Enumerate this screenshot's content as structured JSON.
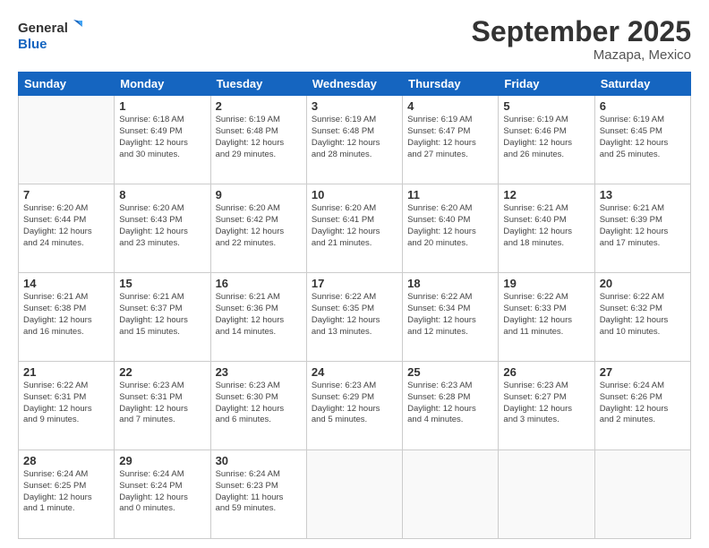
{
  "logo": {
    "line1": "General",
    "line2": "Blue"
  },
  "title": "September 2025",
  "location": "Mazapa, Mexico",
  "weekdays": [
    "Sunday",
    "Monday",
    "Tuesday",
    "Wednesday",
    "Thursday",
    "Friday",
    "Saturday"
  ],
  "weeks": [
    [
      {
        "day": "",
        "info": ""
      },
      {
        "day": "1",
        "info": "Sunrise: 6:18 AM\nSunset: 6:49 PM\nDaylight: 12 hours\nand 30 minutes."
      },
      {
        "day": "2",
        "info": "Sunrise: 6:19 AM\nSunset: 6:48 PM\nDaylight: 12 hours\nand 29 minutes."
      },
      {
        "day": "3",
        "info": "Sunrise: 6:19 AM\nSunset: 6:48 PM\nDaylight: 12 hours\nand 28 minutes."
      },
      {
        "day": "4",
        "info": "Sunrise: 6:19 AM\nSunset: 6:47 PM\nDaylight: 12 hours\nand 27 minutes."
      },
      {
        "day": "5",
        "info": "Sunrise: 6:19 AM\nSunset: 6:46 PM\nDaylight: 12 hours\nand 26 minutes."
      },
      {
        "day": "6",
        "info": "Sunrise: 6:19 AM\nSunset: 6:45 PM\nDaylight: 12 hours\nand 25 minutes."
      }
    ],
    [
      {
        "day": "7",
        "info": "Sunrise: 6:20 AM\nSunset: 6:44 PM\nDaylight: 12 hours\nand 24 minutes."
      },
      {
        "day": "8",
        "info": "Sunrise: 6:20 AM\nSunset: 6:43 PM\nDaylight: 12 hours\nand 23 minutes."
      },
      {
        "day": "9",
        "info": "Sunrise: 6:20 AM\nSunset: 6:42 PM\nDaylight: 12 hours\nand 22 minutes."
      },
      {
        "day": "10",
        "info": "Sunrise: 6:20 AM\nSunset: 6:41 PM\nDaylight: 12 hours\nand 21 minutes."
      },
      {
        "day": "11",
        "info": "Sunrise: 6:20 AM\nSunset: 6:40 PM\nDaylight: 12 hours\nand 20 minutes."
      },
      {
        "day": "12",
        "info": "Sunrise: 6:21 AM\nSunset: 6:40 PM\nDaylight: 12 hours\nand 18 minutes."
      },
      {
        "day": "13",
        "info": "Sunrise: 6:21 AM\nSunset: 6:39 PM\nDaylight: 12 hours\nand 17 minutes."
      }
    ],
    [
      {
        "day": "14",
        "info": "Sunrise: 6:21 AM\nSunset: 6:38 PM\nDaylight: 12 hours\nand 16 minutes."
      },
      {
        "day": "15",
        "info": "Sunrise: 6:21 AM\nSunset: 6:37 PM\nDaylight: 12 hours\nand 15 minutes."
      },
      {
        "day": "16",
        "info": "Sunrise: 6:21 AM\nSunset: 6:36 PM\nDaylight: 12 hours\nand 14 minutes."
      },
      {
        "day": "17",
        "info": "Sunrise: 6:22 AM\nSunset: 6:35 PM\nDaylight: 12 hours\nand 13 minutes."
      },
      {
        "day": "18",
        "info": "Sunrise: 6:22 AM\nSunset: 6:34 PM\nDaylight: 12 hours\nand 12 minutes."
      },
      {
        "day": "19",
        "info": "Sunrise: 6:22 AM\nSunset: 6:33 PM\nDaylight: 12 hours\nand 11 minutes."
      },
      {
        "day": "20",
        "info": "Sunrise: 6:22 AM\nSunset: 6:32 PM\nDaylight: 12 hours\nand 10 minutes."
      }
    ],
    [
      {
        "day": "21",
        "info": "Sunrise: 6:22 AM\nSunset: 6:31 PM\nDaylight: 12 hours\nand 9 minutes."
      },
      {
        "day": "22",
        "info": "Sunrise: 6:23 AM\nSunset: 6:31 PM\nDaylight: 12 hours\nand 7 minutes."
      },
      {
        "day": "23",
        "info": "Sunrise: 6:23 AM\nSunset: 6:30 PM\nDaylight: 12 hours\nand 6 minutes."
      },
      {
        "day": "24",
        "info": "Sunrise: 6:23 AM\nSunset: 6:29 PM\nDaylight: 12 hours\nand 5 minutes."
      },
      {
        "day": "25",
        "info": "Sunrise: 6:23 AM\nSunset: 6:28 PM\nDaylight: 12 hours\nand 4 minutes."
      },
      {
        "day": "26",
        "info": "Sunrise: 6:23 AM\nSunset: 6:27 PM\nDaylight: 12 hours\nand 3 minutes."
      },
      {
        "day": "27",
        "info": "Sunrise: 6:24 AM\nSunset: 6:26 PM\nDaylight: 12 hours\nand 2 minutes."
      }
    ],
    [
      {
        "day": "28",
        "info": "Sunrise: 6:24 AM\nSunset: 6:25 PM\nDaylight: 12 hours\nand 1 minute."
      },
      {
        "day": "29",
        "info": "Sunrise: 6:24 AM\nSunset: 6:24 PM\nDaylight: 12 hours\nand 0 minutes."
      },
      {
        "day": "30",
        "info": "Sunrise: 6:24 AM\nSunset: 6:23 PM\nDaylight: 11 hours\nand 59 minutes."
      },
      {
        "day": "",
        "info": ""
      },
      {
        "day": "",
        "info": ""
      },
      {
        "day": "",
        "info": ""
      },
      {
        "day": "",
        "info": ""
      }
    ]
  ]
}
